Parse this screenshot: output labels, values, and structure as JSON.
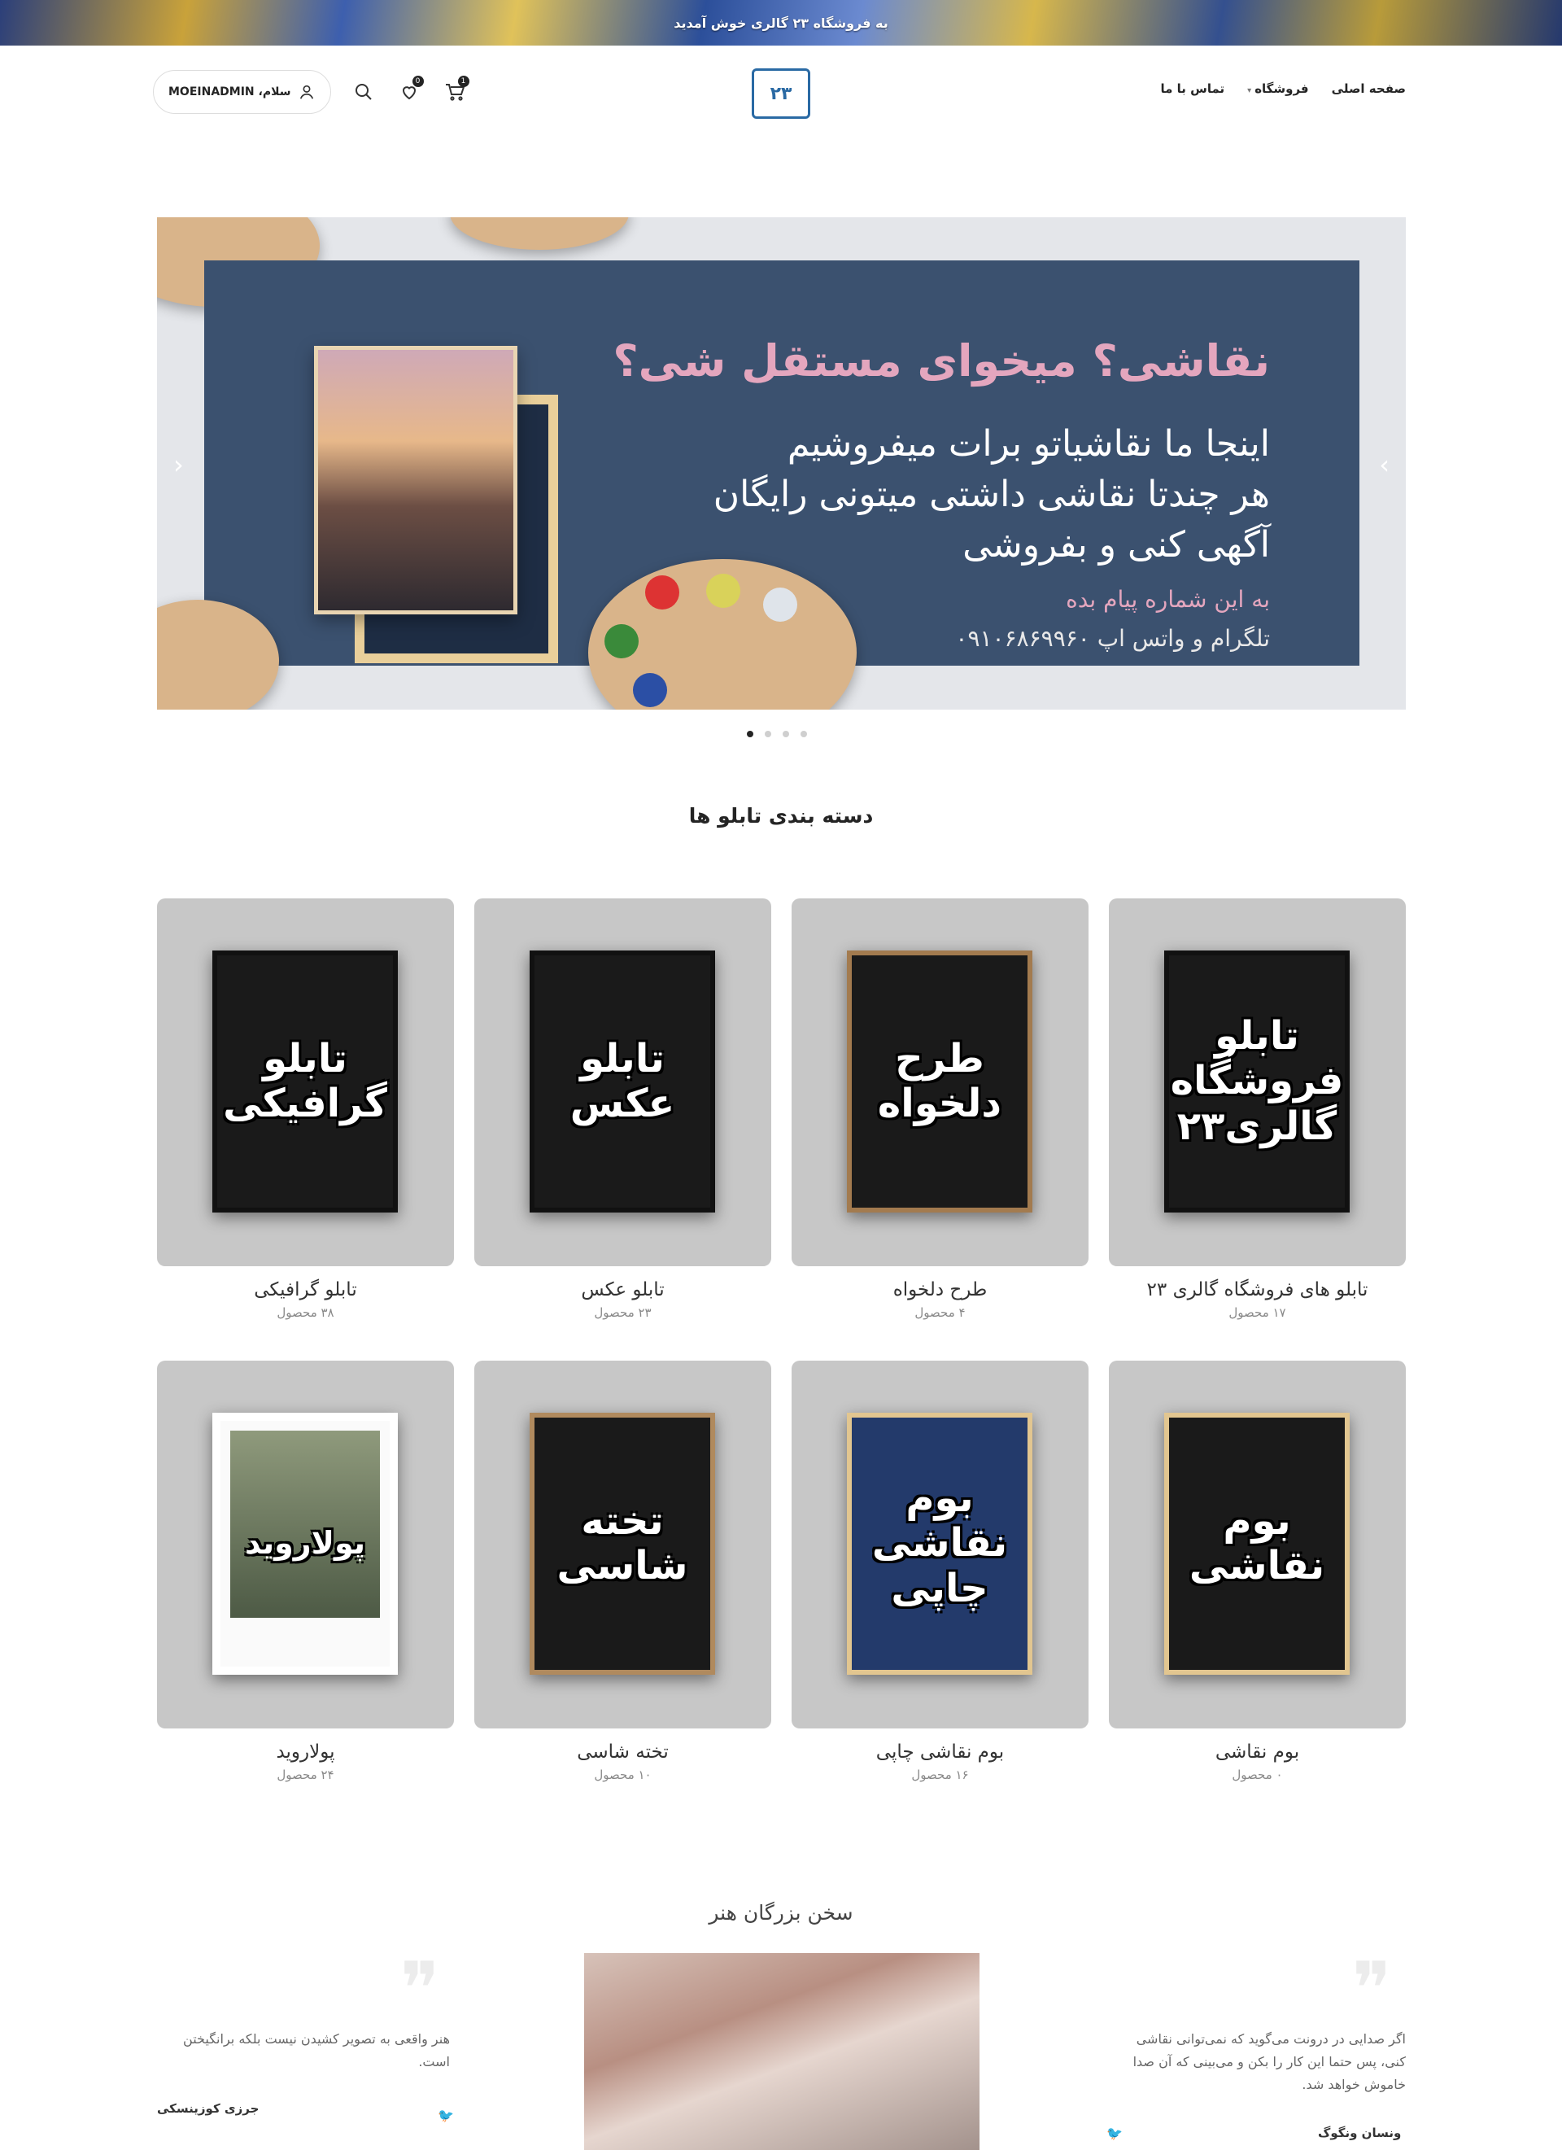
{
  "topbar": {
    "text": "به فروشگاه ۲۳ گالری خوش آمدید"
  },
  "nav": [
    {
      "label": "صفحه اصلی"
    },
    {
      "label": "فروشگاه"
    },
    {
      "label": "تماس با ما"
    }
  ],
  "logo": {
    "text": "۲۳"
  },
  "user": {
    "greeting": "سلام، MOEINADMIN"
  },
  "wishlist": {
    "count": "0"
  },
  "cart": {
    "count": "1"
  },
  "slider": {
    "heading": "نقاشی؟ میخوای مستقل شی؟",
    "lines": [
      "اینجا ما نقاشیاتو برات میفروشیم",
      "هر چندتا نقاشی داشتی میتونی رایگان",
      "آگهی کنی و بفروشی"
    ],
    "cta": "به این شماره پیام بده",
    "contact": "تلگرام و واتس اپ ۰۹۱۰۶۸۶۹۹۶۰",
    "accent_color": "#e4a6be",
    "panel_color": "#3b516f",
    "active_dot": 0
  },
  "categories_title": "دسته بندی تابلو ها",
  "categories": [
    {
      "name": "تابلو های فروشگاه گالری ۲۳",
      "count": "۱۷ محصول",
      "poster": "تابلو فروشگاه گالری۲۳"
    },
    {
      "name": "طرح دلخواه",
      "count": "۴ محصول",
      "poster": "طرح دلخواه"
    },
    {
      "name": "تابلو عکس",
      "count": "۲۳ محصول",
      "poster": "تابلو عکس"
    },
    {
      "name": "تابلو گرافیکی",
      "count": "۳۸ محصول",
      "poster": "تابلو گرافیکی"
    },
    {
      "name": "بوم نقاشی",
      "count": "۰ محصول",
      "poster": "بوم نقاشی"
    },
    {
      "name": "بوم نقاشی چاپی",
      "count": "۱۶ محصول",
      "poster": "بوم نقاشی چاپی"
    },
    {
      "name": "تخته شاسی",
      "count": "۱۰ محصول",
      "poster": "تخته شاسی"
    },
    {
      "name": "پولاروید",
      "count": "۲۴ محصول",
      "poster": "پولاروید"
    }
  ],
  "quotes_title": "سخن بزرگان هنر",
  "quotes": [
    {
      "text": "اگر صدایی در درونت می‌گوید که نمی‌توانی نقاشی کنی، پس حتما این کار را بکن و می‌بینی که آن صدا خاموش خواهد شد.",
      "author": "ونسان ونگوگ"
    },
    {
      "text": "هنر واقعی به تصویر کشیدن نیست بلکه برانگیختن است.",
      "author": "جرزی کوزینسکی"
    }
  ]
}
